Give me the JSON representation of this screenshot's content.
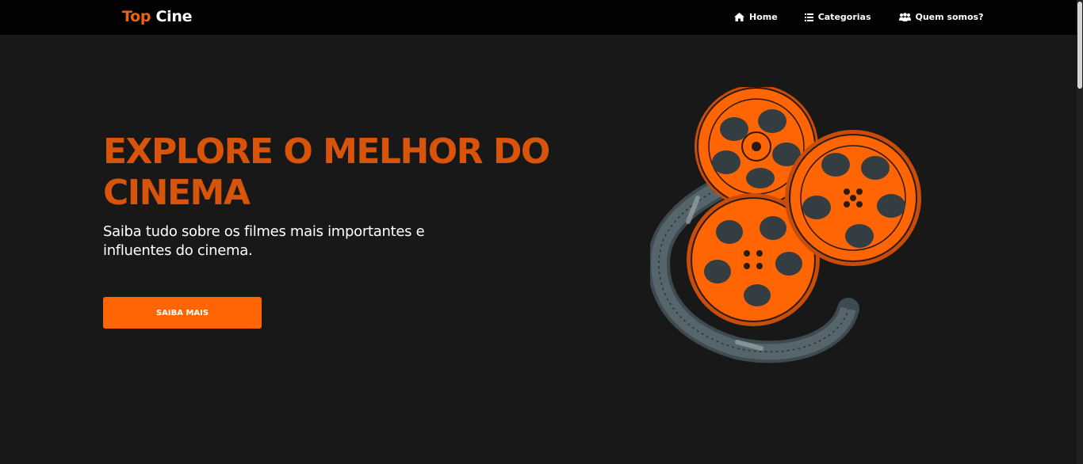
{
  "nav": {
    "logo_part1": "Top",
    "logo_part2": "Cine",
    "links": [
      {
        "label": "Home",
        "icon": "home-icon"
      },
      {
        "label": "Categorias",
        "icon": "list-icon"
      },
      {
        "label": "Quem somos?",
        "icon": "users-icon"
      }
    ]
  },
  "hero": {
    "title": "EXPLORE O MELHOR DO CINEMA",
    "subtitle": "Saiba tudo sobre os filmes mais importantes e influentes do cinema.",
    "button_label": "SAIBA MAIS",
    "illustration_icon": "film-reels-icon"
  },
  "colors": {
    "accent": "#ff6503",
    "title": "#d9540b",
    "background": "#181818",
    "navbar": "#020202"
  }
}
